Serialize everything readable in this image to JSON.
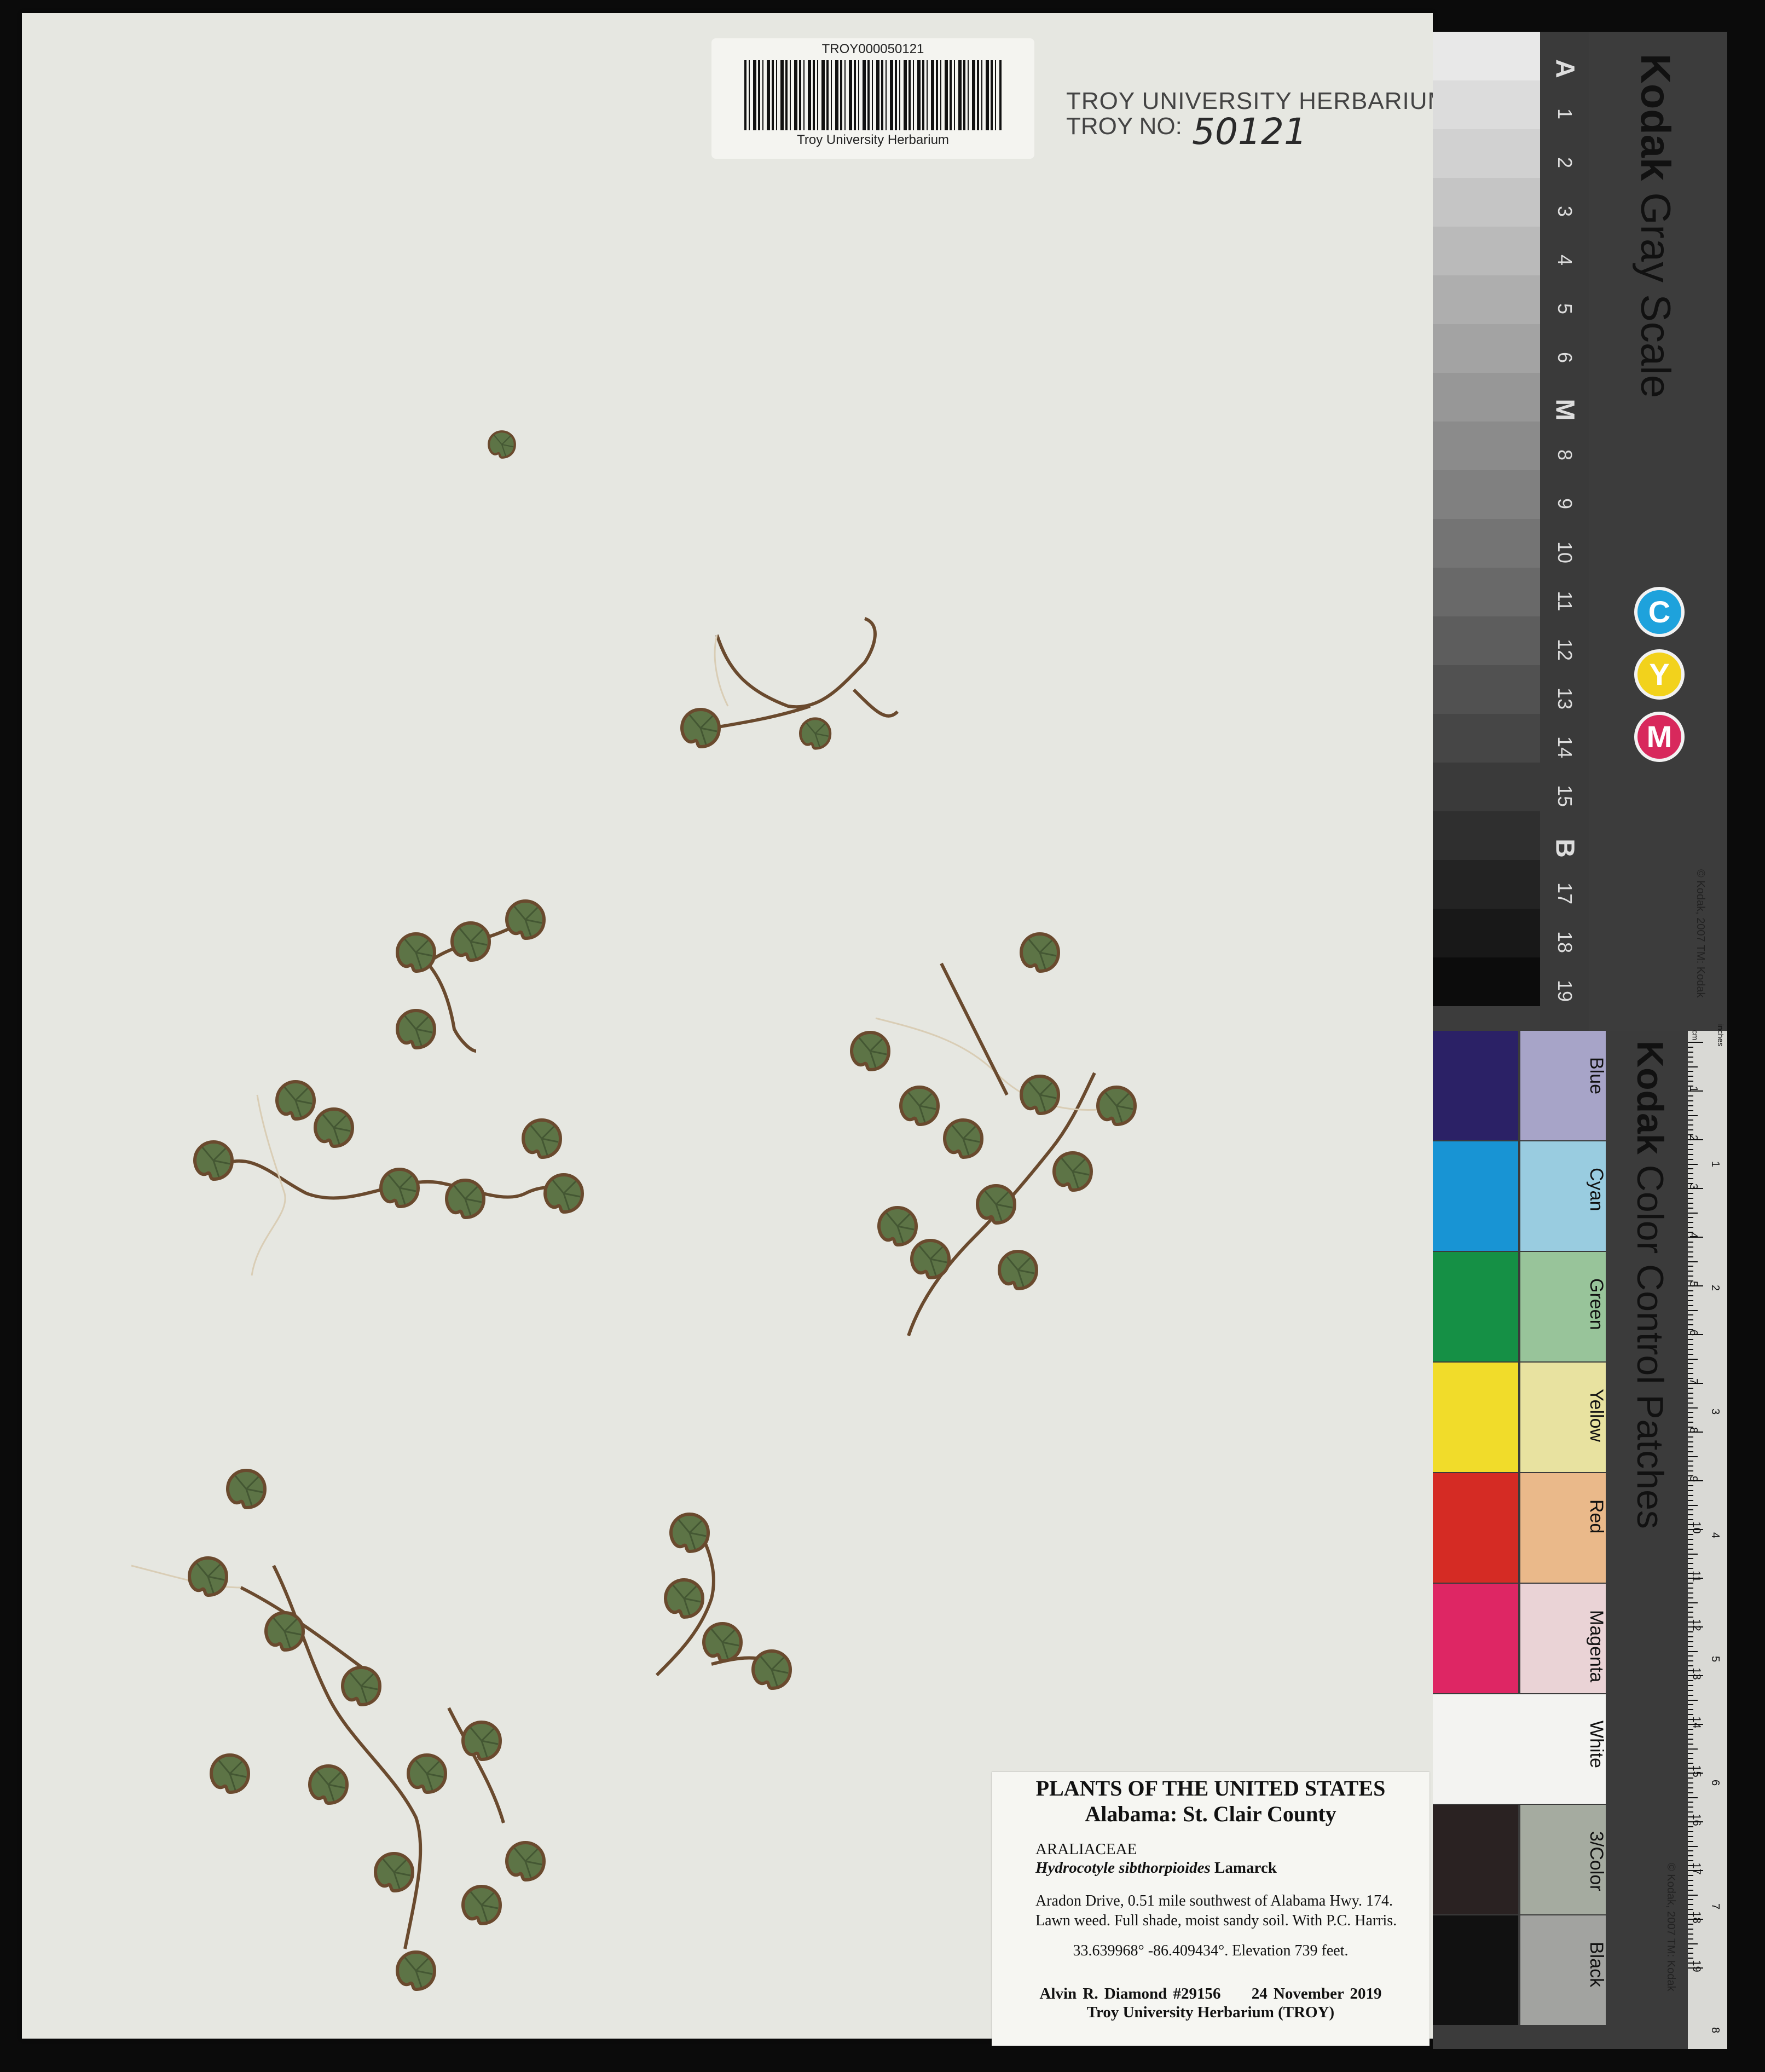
{
  "barcode": {
    "id": "TROY000050121",
    "institution": "Troy University Herbarium"
  },
  "stamp": {
    "line1": "TROY UNIVERSITY HERBARIUM",
    "line2_prefix": "TROY NO:",
    "number": "50121"
  },
  "label": {
    "title": "PLANTS OF THE UNITED STATES",
    "region": "Alabama: St. Clair County",
    "family": "ARALIACEAE",
    "species": "Hydrocotyle sibthorpioides",
    "author": "Lamarck",
    "locality_line1": "Aradon Drive, 0.51 mile southwest of Alabama Hwy. 174.",
    "locality_line2": "Lawn weed. Full shade, moist sandy soil. With P.C. Harris.",
    "coordinates": "33.639968°  -86.409434°. Elevation 739 feet.",
    "collector": "Alvin R. Diamond #29156",
    "date": "24 November 2019",
    "herbarium": "Troy University Herbarium (TROY)"
  },
  "gray_scale": {
    "brand": "Kodak",
    "name": "Gray Scale",
    "steps": [
      "A",
      "1",
      "2",
      "3",
      "4",
      "5",
      "6",
      "M",
      "8",
      "9",
      "10",
      "11",
      "12",
      "13",
      "14",
      "15",
      "B",
      "17",
      "18",
      "19"
    ],
    "dots": [
      "C",
      "Y",
      "M"
    ],
    "copyright": "© Kodak, 2007 TM: Kodak"
  },
  "color_control": {
    "brand": "Kodak",
    "name": "Color Control Patches",
    "patches": [
      "Blue",
      "Cyan",
      "Green",
      "Yellow",
      "Red",
      "Magenta",
      "White",
      "3/Color",
      "Black"
    ],
    "copyright": "© Kodak, 2007 TM: Kodak",
    "ruler_units": [
      "inches",
      "cm"
    ],
    "cm_marks": [
      "1",
      "2",
      "3",
      "4",
      "5",
      "6",
      "7",
      "8",
      "9",
      "10",
      "11",
      "12",
      "13",
      "14",
      "15",
      "16",
      "17",
      "18",
      "19"
    ],
    "inch_marks": [
      "1",
      "2",
      "3",
      "4",
      "5",
      "6",
      "7",
      "8"
    ]
  },
  "colors": {
    "sheet": "#e6e7e1",
    "cyan": "#1ea2dc",
    "yellow": "#f2d21c",
    "magenta": "#d8285c"
  }
}
